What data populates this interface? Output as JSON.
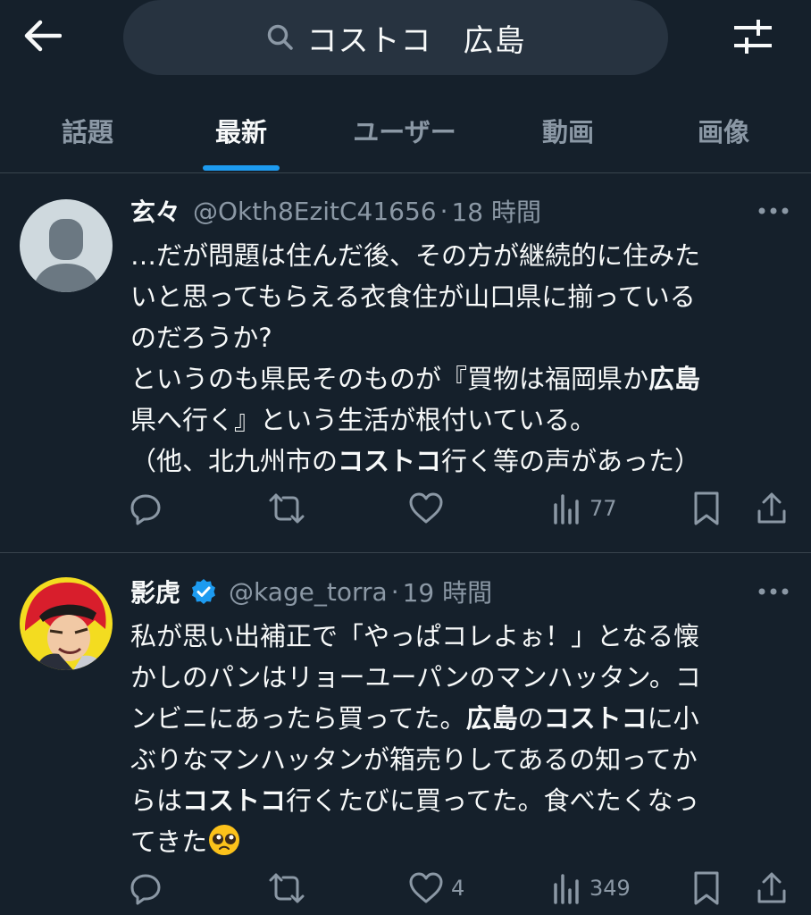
{
  "search": {
    "query": "コストコ　広島"
  },
  "tabs": [
    {
      "label": "話題",
      "active": false
    },
    {
      "label": "最新",
      "active": true
    },
    {
      "label": "ユーザー",
      "active": false
    },
    {
      "label": "動画",
      "active": false
    },
    {
      "label": "画像",
      "active": false
    }
  ],
  "colors": {
    "background": "#15202b",
    "accent": "#1d9bf0",
    "muted": "#8b98a5",
    "verified": "#1d9bf0"
  },
  "tweets": [
    {
      "name": "玄々",
      "handle": "@Okth8EzitC41656",
      "separator": "·",
      "time": "18 時間",
      "verified": false,
      "avatar": "default-avatar",
      "lines": [
        [
          "…だが問題は住んだ後、その方が継続的に住みた"
        ],
        [
          "いと思ってもらえる衣食住が山口県に揃っている"
        ],
        [
          "のだろうか?"
        ],
        [
          "というのも県民そのものが『買物は福岡県か",
          "広島"
        ],
        [
          "県へ行く』という生活が根付いている。"
        ],
        [
          "（他、北九州市の",
          "コストコ",
          "行く等の声があった）"
        ]
      ],
      "stats": {
        "replies": "",
        "retweets": "",
        "likes": "",
        "views": "77"
      }
    },
    {
      "name": "影虎",
      "handle": "@kage_torra",
      "separator": "·",
      "time": "19 時間",
      "verified": true,
      "avatar": "anime-character-avatar",
      "lines": [
        [
          "私が思い出補正で「やっぱコレよぉ！」となる懐"
        ],
        [
          "かしのパンはリョーユーパンのマンハッタン。コ"
        ],
        [
          "ンビニにあったら買ってた。",
          "広島",
          "の",
          "コストコ",
          "に小"
        ],
        [
          "ぶりなマンハッタンが箱売りしてあるの知ってか"
        ],
        [
          "らは",
          "コストコ",
          "行くたびに買ってた。食べたくなっ"
        ],
        [
          "てきた",
          "🥺"
        ]
      ],
      "stats": {
        "replies": "",
        "retweets": "",
        "likes": "4",
        "views": "349"
      }
    }
  ]
}
